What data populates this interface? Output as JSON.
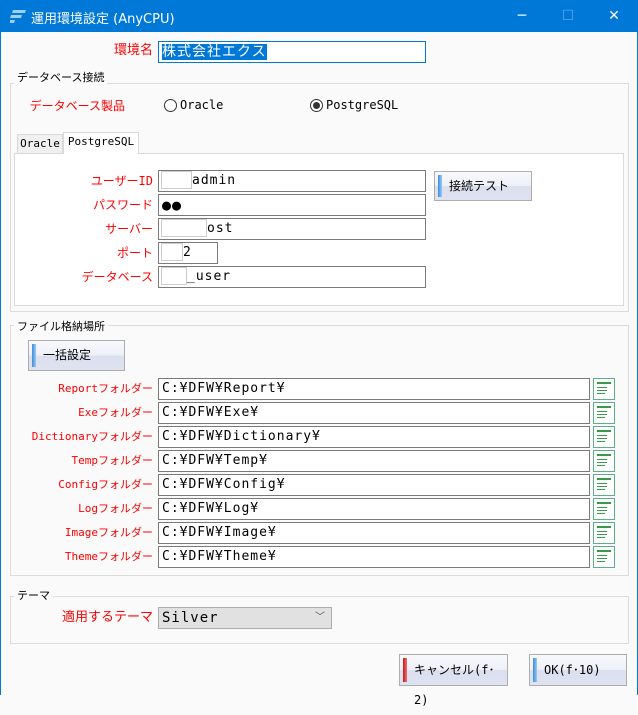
{
  "window": {
    "title": "運用環境設定 (AnyCPU)",
    "minimize": "─",
    "maximize": "☐",
    "close": "✕"
  },
  "env": {
    "label": "環境名",
    "value": "株式会社エクス"
  },
  "db_group": {
    "legend": "データベース接続",
    "product_label": "データベース製品",
    "options": [
      "Oracle",
      "PostgreSQL"
    ],
    "selected": "PostgreSQL",
    "tabs": [
      "Oracle",
      "PostgreSQL"
    ],
    "active_tab": "PostgreSQL",
    "fields": {
      "user_label": "ユーザーID",
      "user_value": "admin",
      "password_label": "パスワード",
      "password_value": "●●",
      "server_label": "サーバー",
      "server_value": "ost",
      "port_label": "ポート",
      "port_value": "2",
      "database_label": "データベース",
      "database_value": "_user"
    },
    "test_button": "接続テスト"
  },
  "file_group": {
    "legend": "ファイル格納場所",
    "bulk_button": "一括設定",
    "folders": [
      {
        "label": "Reportフォルダー",
        "value": "C:¥DFW¥Report¥"
      },
      {
        "label": "Exeフォルダー",
        "value": "C:¥DFW¥Exe¥"
      },
      {
        "label": "Dictionaryフォルダー",
        "value": "C:¥DFW¥Dictionary¥"
      },
      {
        "label": "Tempフォルダー",
        "value": "C:¥DFW¥Temp¥"
      },
      {
        "label": "Configフォルダー",
        "value": "C:¥DFW¥Config¥"
      },
      {
        "label": "Logフォルダー",
        "value": "C:¥DFW¥Log¥"
      },
      {
        "label": "Imageフォルダー",
        "value": "C:¥DFW¥Image¥"
      },
      {
        "label": "Themeフォルダー",
        "value": "C:¥DFW¥Theme¥"
      }
    ]
  },
  "theme_group": {
    "legend": "テーマ",
    "label": "適用するテーマ",
    "value": "Silver"
  },
  "buttons": {
    "cancel": "キャンセル(f･2)",
    "ok": "OK(f･10)"
  },
  "colors": {
    "titlebar": "#0078d7",
    "label": "#ff0000",
    "selection": "#0078d7"
  }
}
